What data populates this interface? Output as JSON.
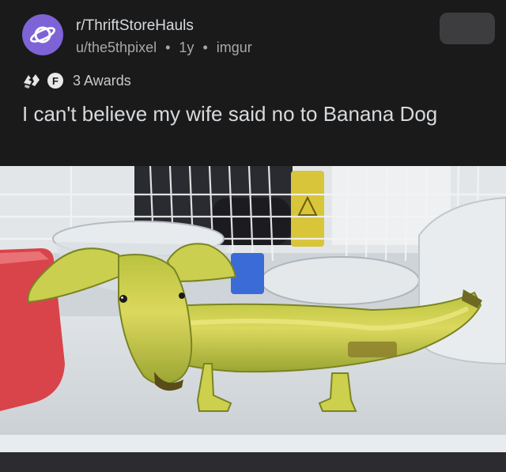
{
  "post": {
    "subreddit": "r/ThriftStoreHauls",
    "author": "u/the5thpixel",
    "separator": "•",
    "age": "1y",
    "source": "imgur",
    "awards_label": "3 Awards",
    "award_letter": "F",
    "title": "I can't believe my wife said no to Banana Dog"
  },
  "icons": {
    "subreddit": "planet-icon",
    "award_1": "hands-award-icon",
    "award_2": "f-award-icon"
  },
  "colors": {
    "background": "#1a1a1b",
    "subreddit_icon": "#7e63d6",
    "banana": "#d6d25a"
  }
}
